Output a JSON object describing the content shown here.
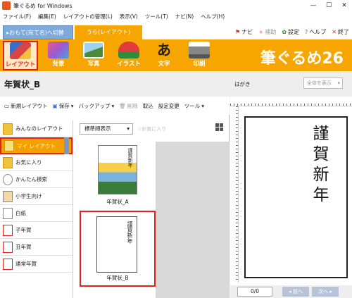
{
  "window": {
    "title": "筆ぐるめ for Windows"
  },
  "menu": [
    "ファイル(F)",
    "編集(E)",
    "レイアウトの管理(L)",
    "表示(V)",
    "ツール(T)",
    "ナビ(N)",
    "ヘルプ(H)"
  ],
  "tabs": {
    "front": "▸おもて(宛て名)へ切替",
    "back": "うら(レイアウト)"
  },
  "top_links": {
    "navi": "ナビ",
    "assist": "補助",
    "settings": "設定",
    "help": "ヘルプ",
    "exit": "終了"
  },
  "toolbar": {
    "items": [
      "レイアウト",
      "背景",
      "写真",
      "イラスト",
      "文字",
      "印刷"
    ],
    "brand": "筆ぐるめ26"
  },
  "page": {
    "title": "年賀状_B"
  },
  "actions": [
    "新規レイアウト",
    "保存",
    "バックアップ",
    "削除",
    "取込",
    "設定変更",
    "ツール"
  ],
  "categories": [
    "みんなのレイアウト",
    "マイ レイアウト",
    "お気に入り",
    "かんたん検索",
    "小学生向け",
    "白紙",
    "子年賀",
    "丑年賀",
    "通常年賀"
  ],
  "sort": {
    "selected": "標準順表示",
    "favorites": "お気に入り"
  },
  "cards": {
    "a_caption": "年賀状_A",
    "b_caption": "年賀状_B",
    "thumb_text": "謹賀新年"
  },
  "preview": {
    "label": "はがき",
    "zoom": "全体を表示",
    "page": "0/0",
    "prev": "前へ",
    "next": "次へ",
    "kanji": "謹賀新年"
  },
  "colors": {
    "accent": "#f7a600",
    "highlight": "#e2211b",
    "tab_front": "#7ea9d8"
  }
}
